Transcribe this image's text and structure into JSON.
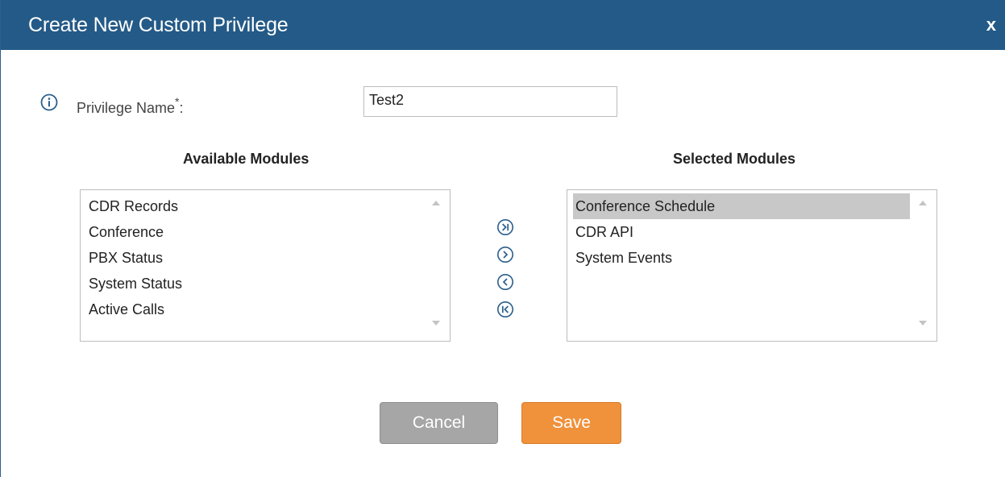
{
  "dialog": {
    "title": "Create New Custom Privilege",
    "close_label": "x"
  },
  "form": {
    "privilege_name_label": "Privilege Name",
    "required_marker": "*",
    "label_suffix": ":",
    "privilege_name_value": "Test2"
  },
  "available": {
    "heading": "Available Modules",
    "items": [
      "CDR Records",
      "Conference",
      "PBX Status",
      "System Status",
      "Active Calls"
    ]
  },
  "selected": {
    "heading": "Selected Modules",
    "items": [
      "Conference Schedule",
      "CDR API",
      "System Events"
    ],
    "highlighted_item": "Conference Schedule"
  },
  "actions": {
    "cancel_label": "Cancel",
    "save_label": "Save"
  },
  "icons": {
    "info": "info-circle-icon",
    "move_all_right": "circle-chevron-bar-right-icon",
    "move_right": "circle-chevron-right-icon",
    "move_left": "circle-chevron-left-icon",
    "move_all_left": "circle-chevron-bar-left-icon"
  },
  "colors": {
    "titlebar": "#245a87",
    "save_button": "#f0913b",
    "cancel_button": "#a6a6a6",
    "icon": "#2b5f8c"
  }
}
